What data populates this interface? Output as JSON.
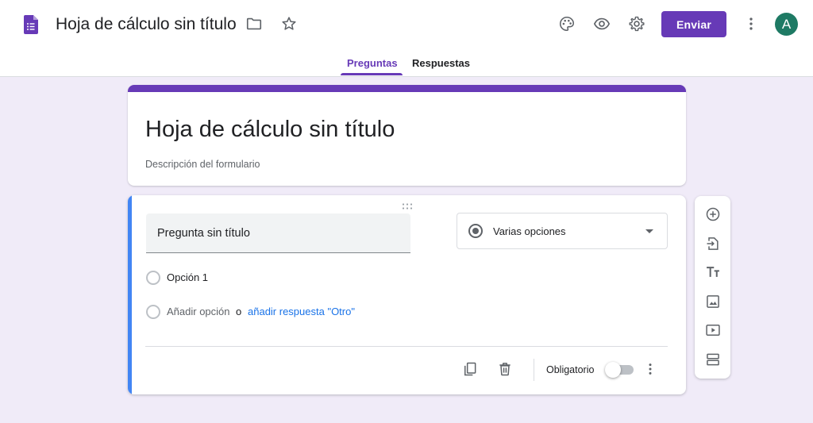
{
  "header": {
    "doc_title": "Hoja de cálculo sin título",
    "send_label": "Enviar",
    "avatar_initial": "A",
    "icons": [
      "forms-app-icon",
      "folder-icon",
      "star-icon",
      "palette-icon",
      "preview-eye-icon",
      "settings-gear-icon",
      "more-vert-icon"
    ]
  },
  "tabs": [
    {
      "label": "Preguntas",
      "active": true
    },
    {
      "label": "Respuestas",
      "active": false
    }
  ],
  "form": {
    "title": "Hoja de cálculo sin título",
    "description_placeholder": "Descripción del formulario"
  },
  "question": {
    "title": "Pregunta sin título",
    "type_label": "Varias opciones",
    "options": [
      "Opción 1"
    ],
    "add_option_label": "Añadir opción",
    "or_label": "o",
    "add_other_label": "añadir respuesta \"Otro\"",
    "required_label": "Obligatorio",
    "required": false
  },
  "side_toolbar": {
    "icons": [
      "add-question-icon",
      "import-questions-icon",
      "add-title-icon",
      "add-image-icon",
      "add-video-icon",
      "add-section-icon"
    ]
  },
  "colors": {
    "accent": "#673ab7",
    "background": "#f0ebf8",
    "focus_bar": "#4285f4",
    "link": "#1a73e8"
  }
}
